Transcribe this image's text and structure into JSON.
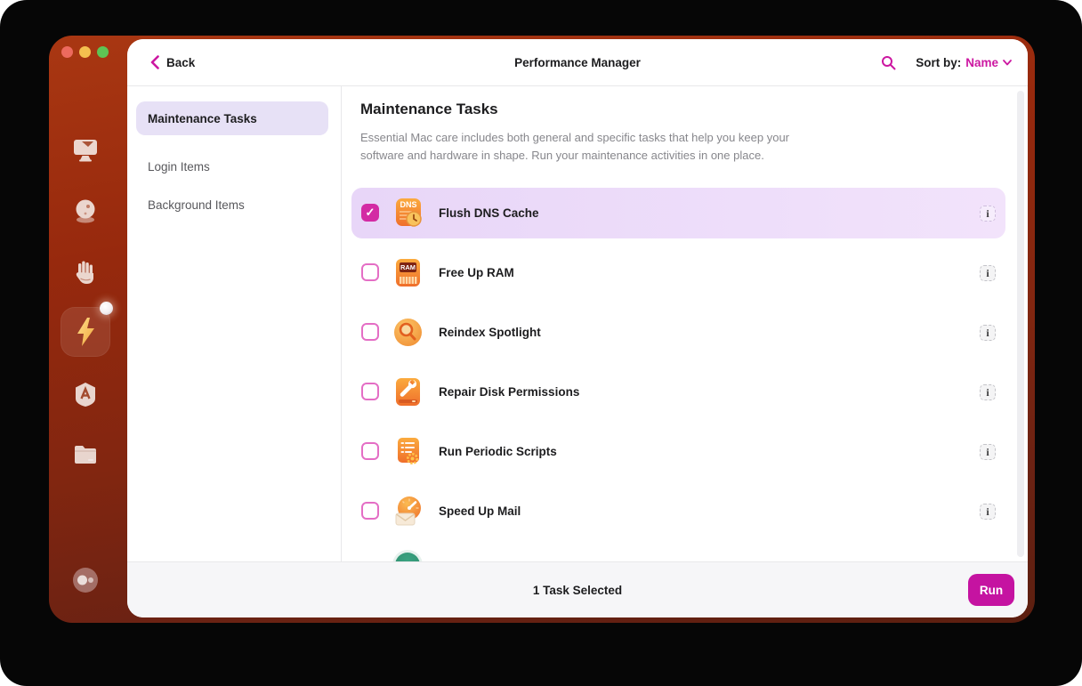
{
  "header": {
    "back_label": "Back",
    "title": "Performance Manager",
    "sort_label": "Sort by:",
    "sort_value": "Name"
  },
  "nav": {
    "items": [
      {
        "label": "Maintenance Tasks",
        "selected": true
      },
      {
        "label": "Login Items",
        "selected": false
      },
      {
        "label": "Background Items",
        "selected": false
      }
    ]
  },
  "main": {
    "title": "Maintenance Tasks",
    "description": "Essential Mac care includes both general and specific tasks that help you keep your software and hardware in shape. Run your maintenance activities in one place."
  },
  "tasks": [
    {
      "label": "Flush DNS Cache",
      "checked": true,
      "icon": "dns-icon",
      "badge": "DNS"
    },
    {
      "label": "Free Up RAM",
      "checked": false,
      "icon": "ram-icon",
      "badge": "RAM"
    },
    {
      "label": "Reindex Spotlight",
      "checked": false,
      "icon": "spotlight-icon",
      "badge": ""
    },
    {
      "label": "Repair Disk Permissions",
      "checked": false,
      "icon": "disk-repair-icon",
      "badge": ""
    },
    {
      "label": "Run Periodic Scripts",
      "checked": false,
      "icon": "scripts-icon",
      "badge": ""
    },
    {
      "label": "Speed Up Mail",
      "checked": false,
      "icon": "mail-icon",
      "badge": ""
    }
  ],
  "info_glyph": "i",
  "footer": {
    "status": "1 Task Selected",
    "run_label": "Run"
  },
  "sidebar": {
    "icons": [
      "imac-icon",
      "cleanup-ball-icon",
      "hand-icon",
      "lightning-icon",
      "applications-icon",
      "folder-icon",
      "assistant-icon"
    ],
    "active_icon": "lightning-icon"
  },
  "colors": {
    "accent": "#cc17a1",
    "run_button": "#c513a1",
    "selected_row": "#e9d8f8",
    "nav_selected_bg": "#e7e1f6",
    "window_top": "#a93712",
    "window_bottom": "#5c1f10"
  }
}
